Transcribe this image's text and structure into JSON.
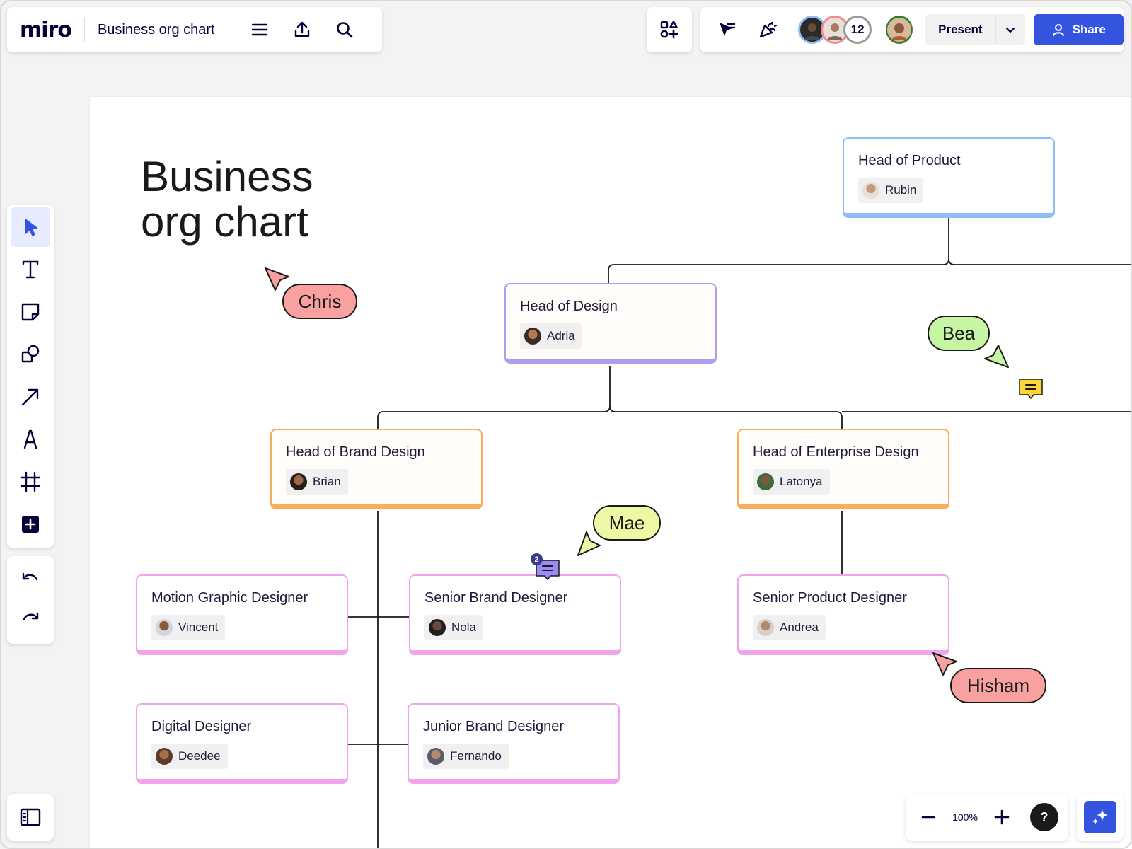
{
  "app": {
    "logo": "miro",
    "board_title": "Business org chart"
  },
  "topbar": {
    "present_label": "Present",
    "share_label": "Share",
    "collaborator_count": "12"
  },
  "canvas": {
    "heading_line1": "Business",
    "heading_line2": "org chart"
  },
  "cards": {
    "product": {
      "title": "Head of Product",
      "person": "Rubin"
    },
    "design": {
      "title": "Head of Design",
      "person": "Adria"
    },
    "brand": {
      "title": "Head of Brand Design",
      "person": "Brian"
    },
    "enterprise": {
      "title": "Head of Enterprise Design",
      "person": "Latonya"
    },
    "motion": {
      "title": "Motion Graphic Designer",
      "person": "Vincent"
    },
    "senior_brand": {
      "title": "Senior Brand Designer",
      "person": "Nola"
    },
    "senior_product": {
      "title": "Senior Product Designer",
      "person": "Andrea"
    },
    "digital": {
      "title": "Digital Designer",
      "person": "Deedee"
    },
    "junior_brand": {
      "title": "Junior Brand Designer",
      "person": "Fernando"
    }
  },
  "cursors": {
    "chris": {
      "name": "Chris",
      "color": "#f9a1a1"
    },
    "bea": {
      "name": "Bea",
      "color": "#c6f5a3"
    },
    "mae": {
      "name": "Mae",
      "color": "#eef7a4"
    },
    "hisham": {
      "name": "Hisham",
      "color": "#f9a1a1"
    }
  },
  "comments": {
    "senior_brand_count": "2"
  },
  "zoom": {
    "level": "100%"
  },
  "help": {
    "label": "?"
  },
  "colors": {
    "accent": "#3453df",
    "product_border": "#8fbef7",
    "design_border": "#ad9ef0",
    "head_border": "#f9ad5a",
    "member_border": "#f2a3ec"
  },
  "icons": [
    "menu-icon",
    "export-icon",
    "search-icon",
    "apps-icon",
    "cursor-filter-icon",
    "celebrate-icon",
    "select-icon",
    "text-icon",
    "sticky-note-icon",
    "shapes-icon",
    "arrow-line-icon",
    "pen-icon",
    "frame-icon",
    "add-icon",
    "undo-icon",
    "redo-icon",
    "panel-icon",
    "zoom-out-icon",
    "zoom-in-icon",
    "ai-sparkle-icon",
    "comment-icon",
    "user-icon",
    "chevron-down-icon"
  ]
}
